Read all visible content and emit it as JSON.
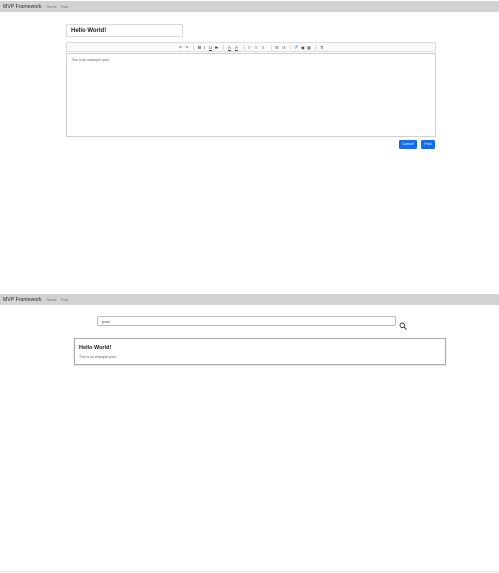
{
  "editor_view": {
    "navbar": {
      "brand": "MVP Framework",
      "links": [
        "Home",
        "Post"
      ]
    },
    "title_value": "Hello World!",
    "toolbar": {
      "undo": "↶",
      "redo": "↷",
      "bold": "B",
      "italic": "I",
      "underline": "U",
      "strike": "S",
      "font_color": "A",
      "highlight": "A",
      "align_left": "≡",
      "align_center": "≡",
      "align_right": "≡",
      "bullet_list": "☰",
      "numbered_list": "☷",
      "link": "🔗",
      "image": "▣",
      "table": "▦",
      "clear_format": "T̸"
    },
    "body_text": "This is an example post",
    "cancel_label": "Cancel",
    "post_label": "Post"
  },
  "search_view": {
    "navbar": {
      "brand": "MVP Framework",
      "links": [
        "Home",
        "Post"
      ]
    },
    "search_value": "post",
    "result": {
      "title": "Hello World!",
      "body": "This is an example post"
    }
  },
  "colors": {
    "navbar_bg": "#d2d2d2",
    "primary": "#0d6efd"
  }
}
